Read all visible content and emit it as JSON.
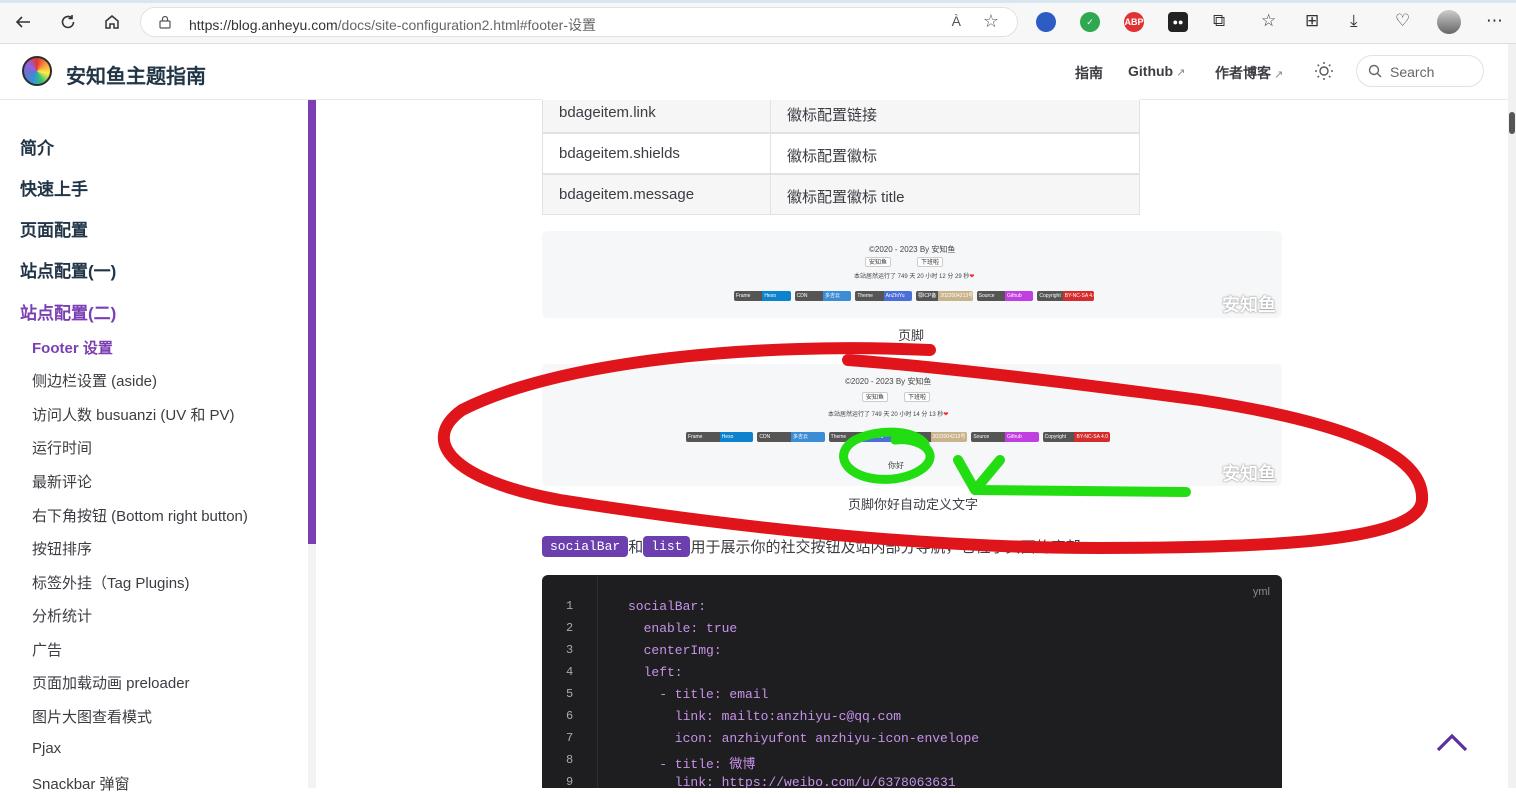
{
  "browser": {
    "url_main": "https://blog.anheyu.com",
    "url_rest": "/docs/site-configuration2.html#footer-设置",
    "read_aloud": "À"
  },
  "header": {
    "site_title": "安知鱼主题指南",
    "nav": [
      "指南",
      "Github",
      "作者博客"
    ],
    "search_placeholder": "Search"
  },
  "sidebar": {
    "sections": [
      "简介",
      "快速上手",
      "页面配置",
      "站点配置(一)",
      "站点配置(二)"
    ],
    "items": [
      "Footer 设置",
      "侧边栏设置 (aside)",
      "访问人数 busuanzi (UV 和 PV)",
      "运行时间",
      "最新评论",
      "右下角按钮 (Bottom right button)",
      "按钮排序",
      "标签外挂（Tag Plugins)",
      "分析统计",
      "广告",
      "页面加载动画 preloader",
      "图片大图查看模式",
      "Pjax",
      "Snackbar 弹窗"
    ]
  },
  "table": {
    "rows": [
      [
        "bdageitem.link",
        "徽标配置链接"
      ],
      [
        "bdageitem.shields",
        "徽标配置徽标"
      ],
      [
        "bdageitem.message",
        "徽标配置徽标 title"
      ]
    ]
  },
  "figure1": {
    "copyright": "©2020 - 2023 By 安知鱼",
    "btn1": "安知鱼",
    "btn2": "下班啦",
    "runtime": "本站居然运行了 749 天 20 小时 12 分 29 秒",
    "watermark": "安知鱼",
    "caption": "页脚"
  },
  "figure2": {
    "copyright": "©2020 - 2023 By 安知鱼",
    "btn1": "安知鱼",
    "btn2": "下班啦",
    "runtime": "本站居然运行了 749 天 20 小时 14 分 13 秒",
    "custom_text": "你好",
    "watermark": "安知鱼",
    "caption": "页脚你好自动定义文字"
  },
  "badges": [
    {
      "l": "Frame",
      "r": "Hexo",
      "color": "#0e83cd"
    },
    {
      "l": "CDN",
      "r": "多吉云",
      "color": "#3c8dd6"
    },
    {
      "l": "Theme",
      "r": "AnZhiYu",
      "color": "#4a6fd8"
    },
    {
      "l": "鄂ICP备",
      "r": "2022004213号",
      "color": "#c8b38a"
    },
    {
      "l": "Source",
      "r": "Github",
      "color": "#c13ee0"
    },
    {
      "l": "Copyright",
      "r": "BY-NC-SA 4.0",
      "color": "#d52d2d"
    }
  ],
  "paragraph": {
    "tag1": "socialBar",
    "joiner": "和",
    "tag2": "list",
    "text": "用于展示你的社交按钮及站内部分导航，它位于页面的底部。"
  },
  "code": {
    "lang": "yml",
    "line_numbers": [
      "1",
      "2",
      "3",
      "4",
      "5",
      "6",
      "7",
      "8",
      "9"
    ],
    "lines": [
      "socialBar:",
      "  enable: true",
      "  centerImg:",
      "  left:",
      "    - title: email",
      "      link: mailto:anzhiyu-c@qq.com",
      "      icon: anzhiyufont anzhiyu-icon-envelope",
      "    - title: 微博",
      "      link: https://weibo.com/u/6378063631"
    ]
  },
  "colors": {
    "accent": "#7b3fb3",
    "annotation_red": "#e0151b",
    "annotation_green": "#22dd11"
  }
}
